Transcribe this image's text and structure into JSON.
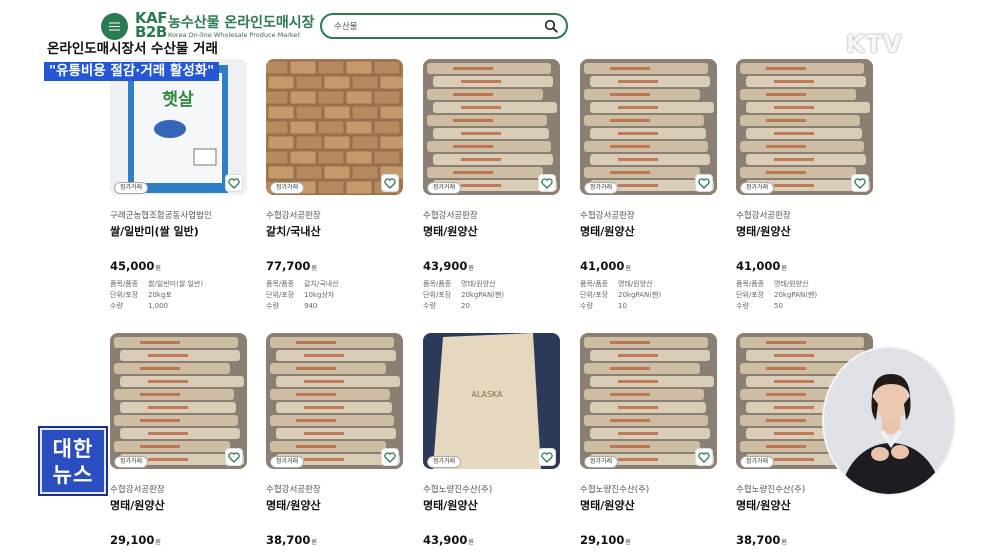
{
  "header": {
    "logo_kaf": "KAF",
    "logo_b2b": "B2B",
    "logo_title": "농수산물 온라인도매시장",
    "logo_subtitle": "Korea On-line Wholesale Produce Market",
    "search_value": "수산물"
  },
  "broadcast": {
    "channel": "KTV",
    "caption_line1": "온라인도매시장서 수산물 거래",
    "caption_line2": "\"유통비용 절감·거래 활성화\"",
    "news_badge_line1": "대한",
    "news_badge_line2": "뉴스"
  },
  "labels": {
    "tag": "정가거래",
    "currency": "원",
    "spec_item": "품목/품종",
    "spec_unit": "단위/포장",
    "spec_qty": "수량"
  },
  "colors": {
    "brand_green": "#2a7a52",
    "news_blue": "#2a4dbf",
    "caption_blue": "#2457d6"
  },
  "products_row1": [
    {
      "seller": "구례군농협조합공동사업법인",
      "name": "쌀/일반미(쌀 일반)",
      "price": "45,000",
      "item": "쌀/일반미(쌀 일반)",
      "unit": "20kg포",
      "qty": "1,000",
      "image": "rice-bag"
    },
    {
      "seller": "수협강서공판장",
      "name": "갈치/국내산",
      "price": "77,700",
      "item": "갈치/국내산",
      "unit": "10kg상자",
      "qty": "940",
      "image": "boxes"
    },
    {
      "seller": "수협강서공판장",
      "name": "명태/원양산",
      "price": "43,900",
      "item": "명태/원양산",
      "unit": "20kgPAN(팬)",
      "qty": "20",
      "image": "sacks"
    },
    {
      "seller": "수협강서공판장",
      "name": "명태/원양산",
      "price": "41,000",
      "item": "명태/원양산",
      "unit": "20kgPAN(팬)",
      "qty": "10",
      "image": "sacks"
    },
    {
      "seller": "수협강서공판장",
      "name": "명태/원양산",
      "price": "41,000",
      "item": "명태/원양산",
      "unit": "20kgPAN(팬)",
      "qty": "50",
      "image": "sacks"
    }
  ],
  "products_row2": [
    {
      "seller": "수협강서공판장",
      "name": "명태/원양산",
      "price": "29,100",
      "image": "sacks"
    },
    {
      "seller": "수협강서공판장",
      "name": "명태/원양산",
      "price": "38,700",
      "image": "sacks"
    },
    {
      "seller": "수협노량진수산(주)",
      "name": "명태/원양산",
      "price": "43,900",
      "image": "single-sack"
    },
    {
      "seller": "수협노량진수산(주)",
      "name": "명태/원양산",
      "price": "29,100",
      "image": "sacks"
    },
    {
      "seller": "수협노량진수산(주)",
      "name": "명태/원양산",
      "price": "38,700",
      "image": "sacks"
    }
  ]
}
